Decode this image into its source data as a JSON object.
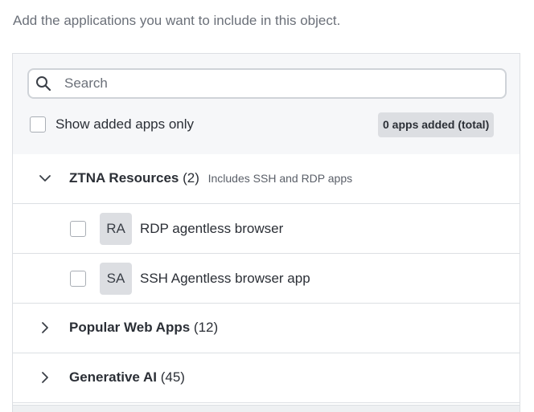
{
  "intro_text": "Add the applications you want to include in this object.",
  "search": {
    "placeholder": "Search",
    "value": ""
  },
  "filter": {
    "show_added_label": "Show added apps only",
    "checked": false
  },
  "badge": {
    "label": "0 apps added (total)"
  },
  "groups": [
    {
      "name": "ZTNA Resources",
      "count": "(2)",
      "description": "Includes SSH and RDP apps",
      "expanded": true,
      "icon": "chevron-down-icon",
      "apps": [
        {
          "initials": "RA",
          "name": "RDP agentless browser",
          "checked": false
        },
        {
          "initials": "SA",
          "name": "SSH Agentless browser app",
          "checked": false
        }
      ]
    },
    {
      "name": "Popular Web Apps",
      "count": "(12)",
      "description": "",
      "expanded": false,
      "icon": "chevron-right-icon"
    },
    {
      "name": "Generative AI",
      "count": "(45)",
      "description": "",
      "expanded": false,
      "icon": "chevron-right-icon"
    }
  ],
  "colors": {
    "panel_header_bg": "#f6f7f9",
    "badge_bg": "#dcdee2",
    "avatar_bg": "#dcdee2",
    "border": "#dcdfe3",
    "text_primary": "#2b2f36",
    "text_muted": "#6b7079"
  }
}
